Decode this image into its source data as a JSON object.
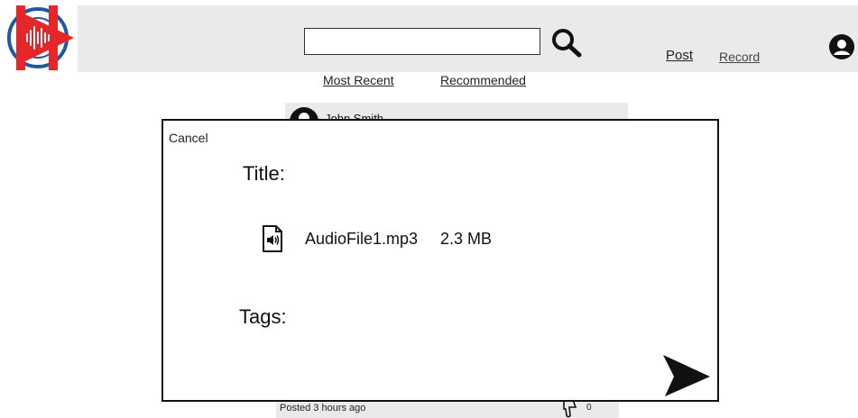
{
  "header": {
    "search_placeholder": "",
    "post_label": "Post",
    "record_label": "Record"
  },
  "tabs": [
    {
      "label": "Most Recent"
    },
    {
      "label": "Recommended"
    }
  ],
  "feed": {
    "author": "John Smith",
    "posted": "Posted 3 hours ago",
    "dislike_count": "0"
  },
  "modal": {
    "cancel_label": "Cancel",
    "title_label": "Title:",
    "file_name": "AudioFile1.mp3",
    "file_size": "2.3 MB",
    "tags_label": "Tags:"
  },
  "colors": {
    "brand_red": "#e5262b",
    "brand_blue": "#1d5a9e",
    "header_bg": "#eaeaea"
  }
}
